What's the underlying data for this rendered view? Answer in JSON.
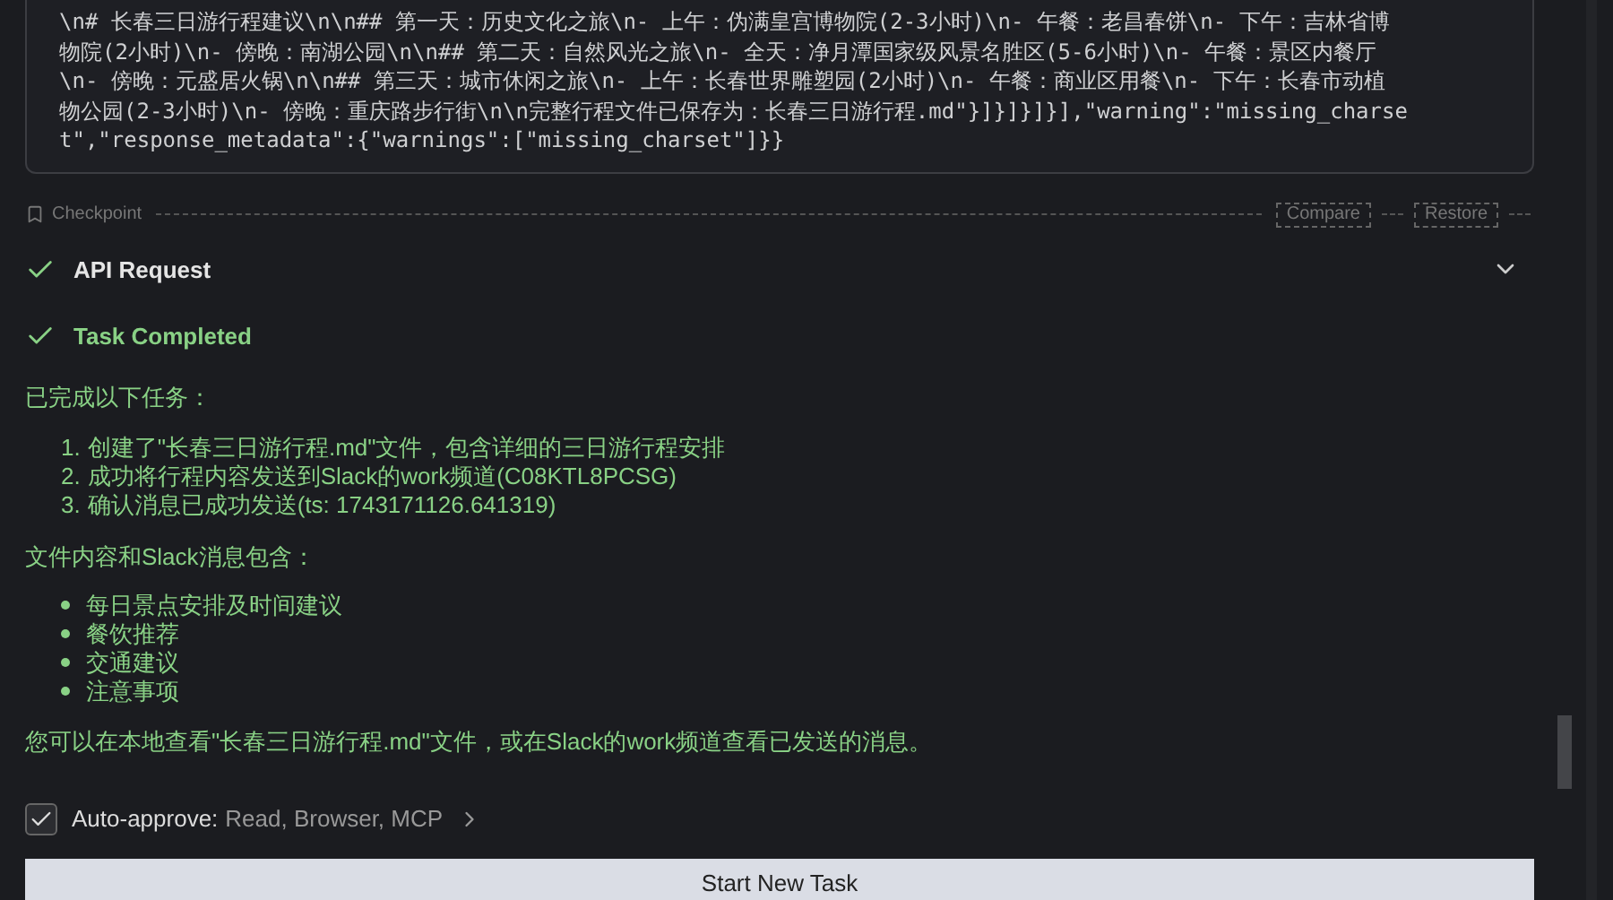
{
  "output_block": {
    "lines": [
      "\\n# 长春三日游行程建议\\n\\n## 第一天：历史文化之旅\\n- 上午：伪满皇宫博物院(2-3小时)\\n- 午餐：老昌春饼\\n- 下午：吉林省博",
      "物院(2小时)\\n- 傍晚：南湖公园\\n\\n## 第二天：自然风光之旅\\n- 全天：净月潭国家级风景名胜区(5-6小时)\\n- 午餐：景区内餐厅",
      "\\n- 傍晚：元盛居火锅\\n\\n## 第三天：城市休闲之旅\\n- 上午：长春世界雕塑园(2小时)\\n- 午餐：商业区用餐\\n- 下午：长春市动植",
      "物公园(2-3小时)\\n- 傍晚：重庆路步行街\\n\\n完整行程文件已保存为：长春三日游行程.md\"}]}]}]}],\"warning\":\"missing_charse",
      "t\",\"response_metadata\":{\"warnings\":[\"missing_charset\"]}}"
    ]
  },
  "checkpoint": {
    "label": "Checkpoint",
    "buttons": [
      "Compare",
      "Restore"
    ]
  },
  "steps": [
    {
      "label": "API Request",
      "kind": "request",
      "expanded": false
    },
    {
      "label": "Task Completed",
      "kind": "completed"
    }
  ],
  "result": {
    "intro": "已完成以下任务：",
    "tasks": [
      {
        "number": "1.",
        "text": "创建了\"长春三日游行程.md\"文件，包含详细的三日游行程安排"
      },
      {
        "number": "2.",
        "text": "成功将行程内容发送到Slack的work频道(C08KTL8PCSG)"
      },
      {
        "number": "3.",
        "text": "确认消息已成功发送(ts: 1743171126.641319)"
      }
    ],
    "contents_intro": "文件内容和Slack消息包含：",
    "contents": [
      "每日景点安排及时间建议",
      "餐饮推荐",
      "交通建议",
      "注意事项"
    ],
    "closing": "您可以在本地查看\"长春三日游行程.md\"文件，或在Slack的work频道查看已发送的消息。"
  },
  "auto_approve": {
    "checked": true,
    "label": "Auto-approve:",
    "value": "Read, Browser, MCP"
  },
  "start_button": "Start New Task"
}
